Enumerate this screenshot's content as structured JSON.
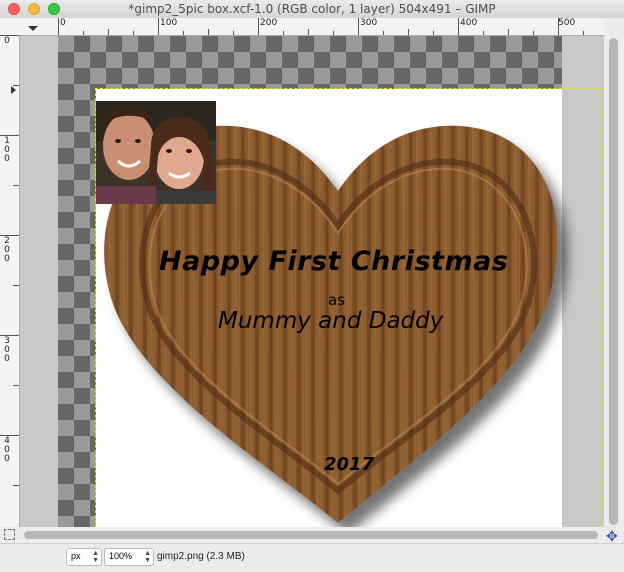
{
  "window": {
    "title": "*gimp2_5pic box.xcf-1.0 (RGB color, 1 layer) 504x491 – GIMP"
  },
  "rulers": {
    "horizontal": [
      "0",
      "100",
      "200",
      "300",
      "400",
      "500"
    ],
    "vertical": [
      "0",
      "100",
      "200",
      "300",
      "400"
    ]
  },
  "canvas": {
    "greeting": "Happy First Christmas",
    "as": "as",
    "parents": "Mummy and Daddy",
    "year": "2017",
    "wood_color": "#8a5a32",
    "wood_light": "#a8733f",
    "wood_dark": "#5e3a1a",
    "guide_color": "#e6e600"
  },
  "statusbar": {
    "unit": "px",
    "zoom": "100%",
    "file_info": "gimp2.png (2.3 MB)"
  },
  "icons": {
    "navigate": "navigate-icon",
    "quick_mask": "quick-mask-icon",
    "menu": "image-menu-icon"
  }
}
